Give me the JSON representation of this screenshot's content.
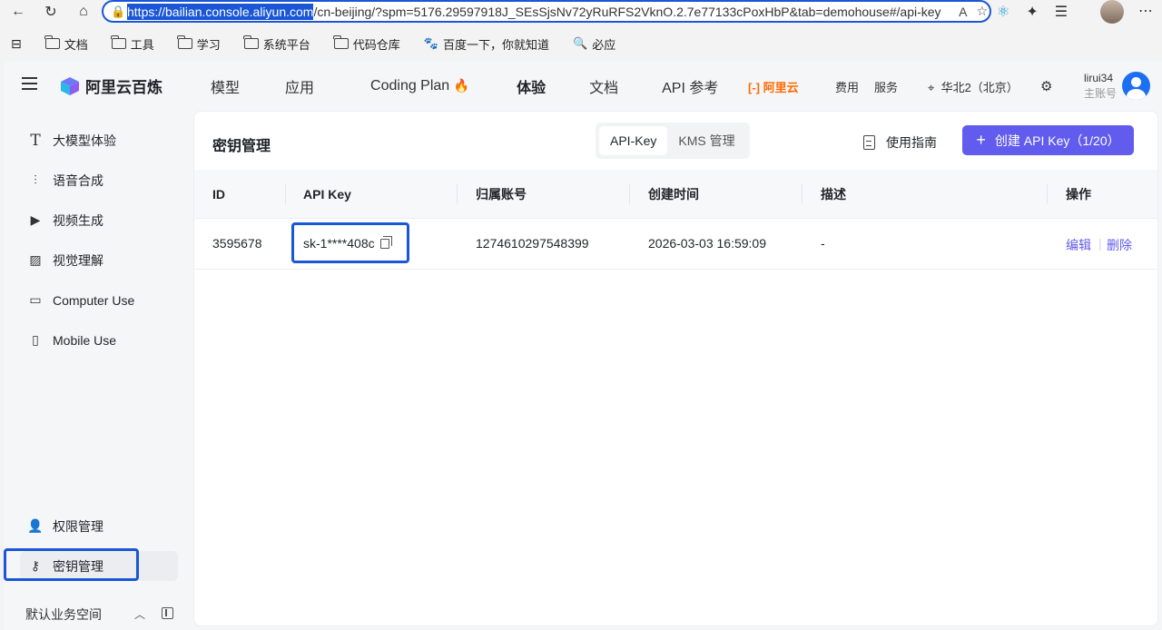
{
  "browser": {
    "url_selected": "https://bailian.console.aliyun.com",
    "url_rest": "/cn-beijing/?spm=5176.29597918J_SEsSjsNv72yRuRFS2VknO.2.7e77133cPoxHbP&tab=demohouse#/api-key",
    "bookmarks": [
      "文档",
      "工具",
      "学习",
      "系统平台",
      "代码仓库",
      "百度一下，你就知道",
      "必应"
    ]
  },
  "header": {
    "brand": "阿里云百炼",
    "nav": [
      "模型",
      "应用",
      "Coding Plan",
      "体验",
      "文档",
      "API 参考"
    ],
    "aliyun": "阿里云",
    "billing": "费用",
    "service": "服务",
    "region": "华北2（北京）",
    "user_name": "lirui34",
    "user_role": "主账号"
  },
  "sidebar": {
    "items": [
      {
        "label": "大模型体验",
        "icon": "text-icon"
      },
      {
        "label": "语音合成",
        "icon": "audio-wave-icon"
      },
      {
        "label": "视频生成",
        "icon": "video-icon"
      },
      {
        "label": "视觉理解",
        "icon": "image-icon"
      },
      {
        "label": "Computer Use",
        "icon": "monitor-icon"
      },
      {
        "label": "Mobile Use",
        "icon": "phone-icon"
      }
    ],
    "permission": "权限管理",
    "key_manage": "密钥管理",
    "workspace": "默认业务空间"
  },
  "main": {
    "title": "密钥管理",
    "tabs": [
      "API-Key",
      "KMS 管理"
    ],
    "guide": "使用指南",
    "create_button": "创建 API Key（1/20）",
    "columns": [
      "ID",
      "API Key",
      "归属账号",
      "创建时间",
      "描述",
      "操作"
    ],
    "rows": [
      {
        "id": "3595678",
        "api_key": "sk-1****408c",
        "account": "1274610297548399",
        "created": "2026-03-03 16:59:09",
        "desc": "-",
        "edit": "编辑",
        "delete": "删除"
      }
    ]
  },
  "colors": {
    "accent": "#615ced",
    "highlight": "#1a56d6",
    "aliyun": "#ff6a00"
  }
}
